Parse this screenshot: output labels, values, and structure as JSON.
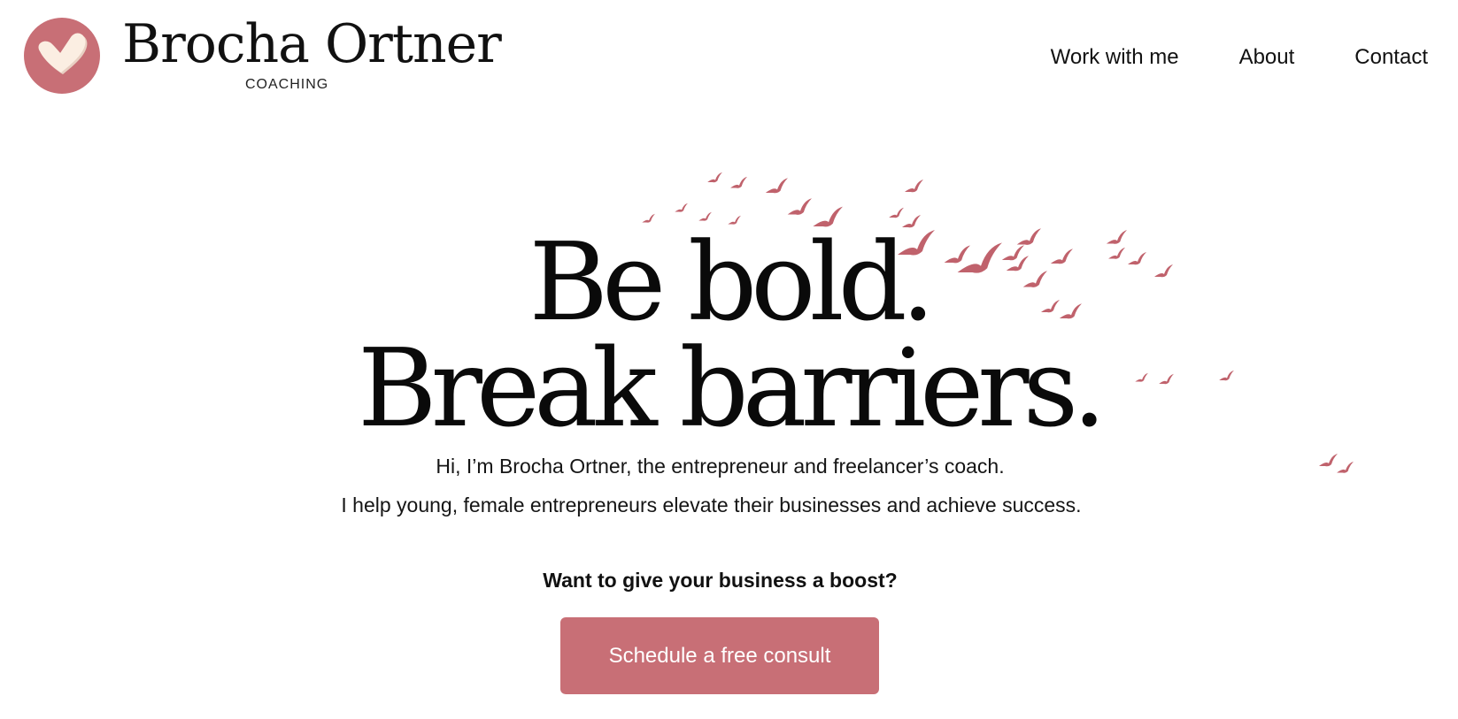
{
  "header": {
    "brand_name": "Brocha Ortner",
    "brand_sub": "COACHING",
    "nav": [
      "Work with me",
      "About",
      "Contact"
    ]
  },
  "hero": {
    "headline_line1": "Be bold.",
    "headline_line2": "Break barriers.",
    "intro_line1": "Hi, I’m Brocha Ortner, the entrepreneur and freelancer’s coach.",
    "intro_line2": "I help young, female entrepreneurs elevate their businesses and achieve success.",
    "cta_prompt": "Want to give your business a boost?",
    "cta_button": "Schedule a free consult"
  },
  "colors": {
    "accent": "#c86f76",
    "logo_heart": "#fbeee2",
    "bird": "#c0626c",
    "text": "#111111",
    "background": "#ffffff"
  },
  "icons": {
    "logo": "heart-logo-icon",
    "decoration": "flock-of-birds-icon"
  }
}
